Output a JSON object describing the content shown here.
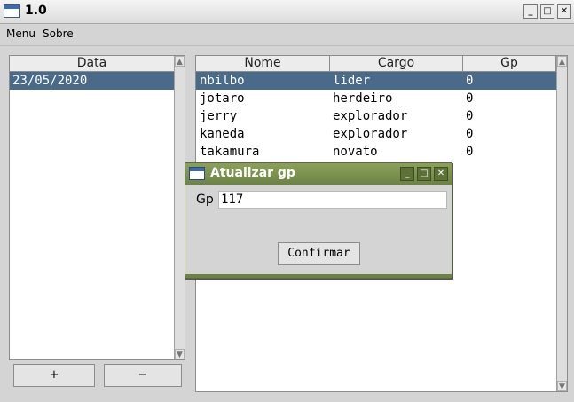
{
  "window": {
    "title": "1.0",
    "icon": "window-icon"
  },
  "menubar": {
    "items": [
      "Menu",
      "Sobre"
    ]
  },
  "dates_panel": {
    "header": "Data",
    "rows": [
      "23/05/2020"
    ],
    "add_label": "+",
    "remove_label": "−"
  },
  "members_table": {
    "headers": [
      "Nome",
      "Cargo",
      "Gp"
    ],
    "rows": [
      [
        "nbilbo",
        "lider",
        "0"
      ],
      [
        "jotaro",
        "herdeiro",
        "0"
      ],
      [
        "jerry",
        "explorador",
        "0"
      ],
      [
        "kaneda",
        "explorador",
        "0"
      ],
      [
        "takamura",
        "novato",
        "0"
      ]
    ]
  },
  "dialog": {
    "title": "Atualizar gp",
    "field_label": "Gp",
    "field_value": "117",
    "confirm_label": "Confirmar"
  },
  "colors": {
    "selection": "#4a6a8a",
    "dialog_title": "#7a9050"
  }
}
